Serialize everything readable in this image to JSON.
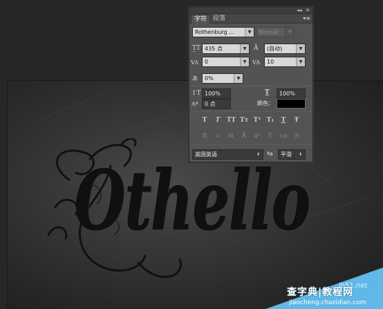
{
  "panel": {
    "tabs": [
      {
        "label": "字符",
        "active": true
      },
      {
        "label": "段落",
        "active": false
      }
    ],
    "font_family": "Rothenburg ...",
    "font_style": "Normal",
    "font_size": "435 点",
    "leading": "(自动)",
    "kerning": "0",
    "tracking": "10",
    "scale_percent": "0%",
    "vertical_scale": "100%",
    "horizontal_scale": "100%",
    "baseline_shift": "0 点",
    "color_label": "颜色：",
    "color_value": "#000000",
    "style_buttons": [
      "T",
      "T",
      "TT",
      "Tт",
      "T¹",
      "T₁",
      "T",
      "Ŧ"
    ],
    "opentype_buttons": [
      "fi",
      "ℴ",
      "st",
      "Ã",
      "aᵈ",
      "T",
      "1st",
      "½"
    ],
    "language": "英国英语",
    "aa_label": "ªa",
    "antialias": "平滑",
    "icons": {
      "font_size": "font-size-icon",
      "leading": "leading-icon",
      "kerning": "kerning-icon",
      "tracking": "tracking-icon",
      "scale": "tsume-icon",
      "vscale": "vertical-scale-icon",
      "hscale": "horizontal-scale-icon",
      "baseline": "baseline-shift-icon"
    }
  },
  "canvas": {
    "art_text": "Othello"
  },
  "watermark": {
    "line1": "查字典",
    "line1b": "教程网",
    "site": "jb51.net",
    "line2": "jiaocheng.chazidian.com"
  }
}
